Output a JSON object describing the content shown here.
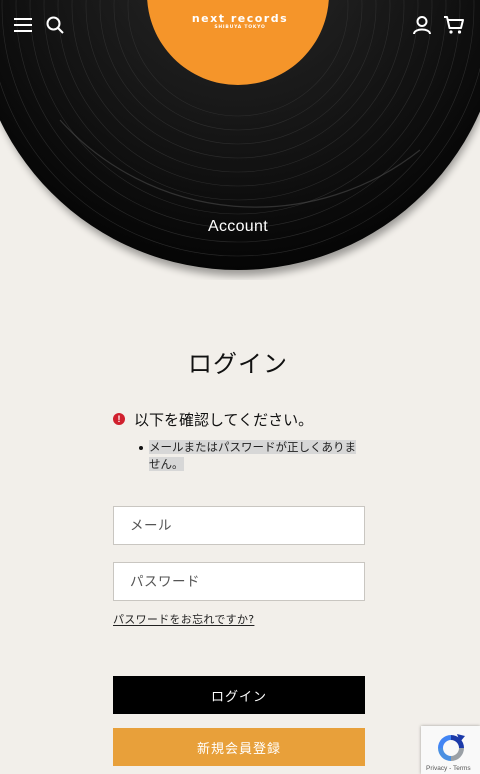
{
  "header": {
    "logo_main": "next records",
    "logo_sub": "SHIBUYA TOKYO",
    "icons": [
      "menu-icon",
      "search-icon",
      "user-icon",
      "cart-icon"
    ],
    "hero_title": "Account"
  },
  "main": {
    "page_title": "ログイン",
    "error": {
      "icon": "!",
      "heading": "以下を確認してください。",
      "items": [
        "メールまたはパスワードが正しくありません。"
      ]
    },
    "form": {
      "email_placeholder": "メール",
      "email_value": "",
      "password_placeholder": "パスワード",
      "password_value": "",
      "forgot_link": "パスワードをお忘れですか?",
      "login_button": "ログイン",
      "register_button": "新規会員登録"
    }
  },
  "recaptcha": {
    "text": "Privacy - Terms"
  },
  "colors": {
    "background": "#f2efea",
    "record_label": "#f5952a",
    "error_red": "#d0202e",
    "register_button": "#e8a03a",
    "login_button": "#000000"
  }
}
